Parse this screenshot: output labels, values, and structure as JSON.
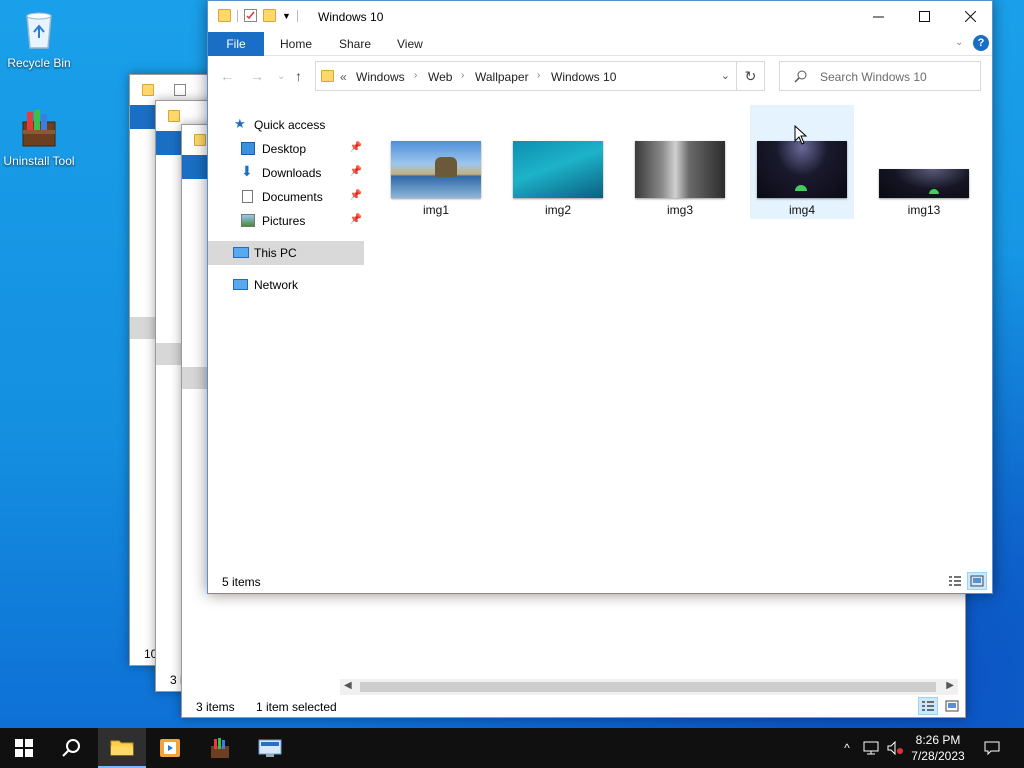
{
  "desktop": {
    "icons": [
      {
        "label": "Recycle Bin"
      },
      {
        "label": "Uninstall Tool"
      }
    ]
  },
  "background_windows": [
    {
      "status_text": "10"
    },
    {
      "status_text": "3 i"
    },
    {
      "status_text": "3 items",
      "status_selected": "1 item selected"
    }
  ],
  "explorer": {
    "title": "Windows 10",
    "ribbon_tabs": {
      "file": "File",
      "home": "Home",
      "share": "Share",
      "view": "View"
    },
    "address": {
      "prefix": "«",
      "crumbs": [
        "Windows",
        "Web",
        "Wallpaper",
        "Windows 10"
      ]
    },
    "search": {
      "placeholder": "Search Windows 10"
    },
    "nav": {
      "quick_access": "Quick access",
      "desktop": "Desktop",
      "downloads": "Downloads",
      "documents": "Documents",
      "pictures": "Pictures",
      "this_pc": "This PC",
      "network": "Network"
    },
    "files": [
      {
        "name": "img1"
      },
      {
        "name": "img2"
      },
      {
        "name": "img3"
      },
      {
        "name": "img4"
      },
      {
        "name": "img13"
      }
    ],
    "status": "5 items"
  },
  "taskbar": {
    "time": "8:26 PM",
    "date": "7/28/2023"
  },
  "colors": {
    "accent": "#1a6fc4",
    "desktop": "#148fe0",
    "taskbar": "#101010",
    "selection": "#e5f3ff"
  }
}
